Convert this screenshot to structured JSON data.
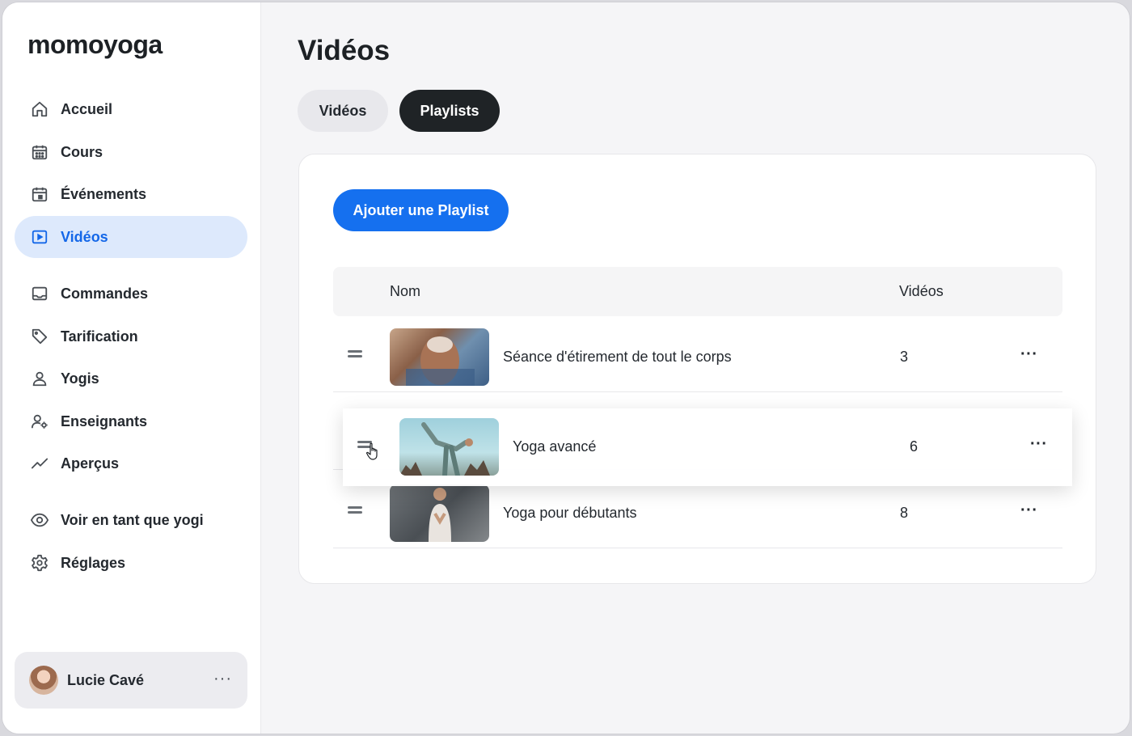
{
  "app": {
    "logo": "momoyoga"
  },
  "sidebar": {
    "items": [
      {
        "label": "Accueil",
        "icon": "home-icon"
      },
      {
        "label": "Cours",
        "icon": "calendar-grid-icon"
      },
      {
        "label": "Événements",
        "icon": "calendar-event-icon"
      },
      {
        "label": "Vidéos",
        "icon": "video-icon",
        "active": true
      },
      {
        "label": "Commandes",
        "icon": "inbox-icon"
      },
      {
        "label": "Tarification",
        "icon": "tag-icon"
      },
      {
        "label": "Yogis",
        "icon": "user-icon"
      },
      {
        "label": "Enseignants",
        "icon": "user-settings-icon"
      },
      {
        "label": "Aperçus",
        "icon": "trend-line-icon"
      },
      {
        "label": "Voir en tant que yogi",
        "icon": "eye-icon"
      },
      {
        "label": "Réglages",
        "icon": "gear-icon"
      }
    ],
    "user": {
      "name": "Lucie Cavé",
      "more": "···"
    }
  },
  "main": {
    "title": "Vidéos",
    "tabs": [
      {
        "label": "Vidéos",
        "active": false
      },
      {
        "label": "Playlists",
        "active": true
      }
    ],
    "add_button": "Ajouter une Playlist",
    "table": {
      "columns": [
        "Nom",
        "Vidéos"
      ],
      "rows": [
        {
          "name": "Séance d'étirement de tout le corps",
          "count": "3",
          "more": "···"
        },
        {
          "name": "Yoga avancé",
          "count": "6",
          "more": "···",
          "dragging": true
        },
        {
          "name": "Yoga pour débutants",
          "count": "8",
          "more": "···"
        }
      ]
    }
  },
  "colors": {
    "accent": "#1570ef",
    "active_nav_bg": "#dde9fc",
    "active_nav_text": "#1467e8",
    "dark_tab": "#1f2326"
  }
}
